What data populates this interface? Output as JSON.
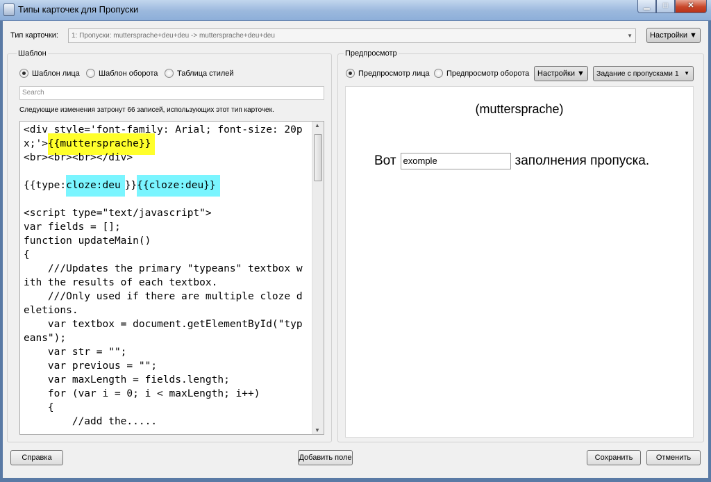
{
  "window": {
    "title": "Типы карточек для Пропуски"
  },
  "top": {
    "card_type_label": "Тип карточки:",
    "card_type_value": "1: Пропуски: muttersprache+deu+deu -> muttersprache+deu+deu",
    "settings_button": "Настройки ▼"
  },
  "template": {
    "group_title": "Шаблон",
    "radios": [
      {
        "label": "Шаблон лица",
        "checked": true
      },
      {
        "label": "Шаблон оборота",
        "checked": false
      },
      {
        "label": "Таблица стилей",
        "checked": false
      }
    ],
    "search_placeholder": "Search",
    "notice": "Следующие изменения затронут 66 записей, использующих этот тип карточек.",
    "code_line1_a": "<div style='font-family: Arial; font-size: 20px;'>",
    "code_line1_b": "{{muttersprache}}",
    "code_line2": "<br><br><br></div>",
    "code_line3_a": "{{type:",
    "code_line3_b": "cloze:deu",
    "code_line3_c": "}}",
    "code_line3_d": "{{cloze:deu}}",
    "code_rest": "<script type=\"text/javascript\">\nvar fields = [];\nfunction updateMain()\n{\n    ///Updates the primary \"typeans\" textbox with the results of each textbox.\n    ///Only used if there are multiple cloze deletions.\n    var textbox = document.getElementById(\"typeans\");\n    var str = \"\";\n    var previous = \"\";\n    var maxLength = fields.length;\n    for (var i = 0; i < maxLength; i++)\n    {\n        //add the....."
  },
  "preview": {
    "group_title": "Предпросмотр",
    "radios": [
      {
        "label": "Предпросмотр лица",
        "checked": true
      },
      {
        "label": "Предпросмотр оборота",
        "checked": false
      }
    ],
    "settings_button": "Настройки ▼",
    "cloze_select": "Задание с пропусками 1",
    "title": "(muttersprache)",
    "text_before": "Вот",
    "input_value": "exomple",
    "text_after": "заполнения пропуска."
  },
  "bottom": {
    "help": "Справка",
    "add_field": "Добавить поле",
    "save": "Сохранить",
    "cancel": "Отменить"
  }
}
